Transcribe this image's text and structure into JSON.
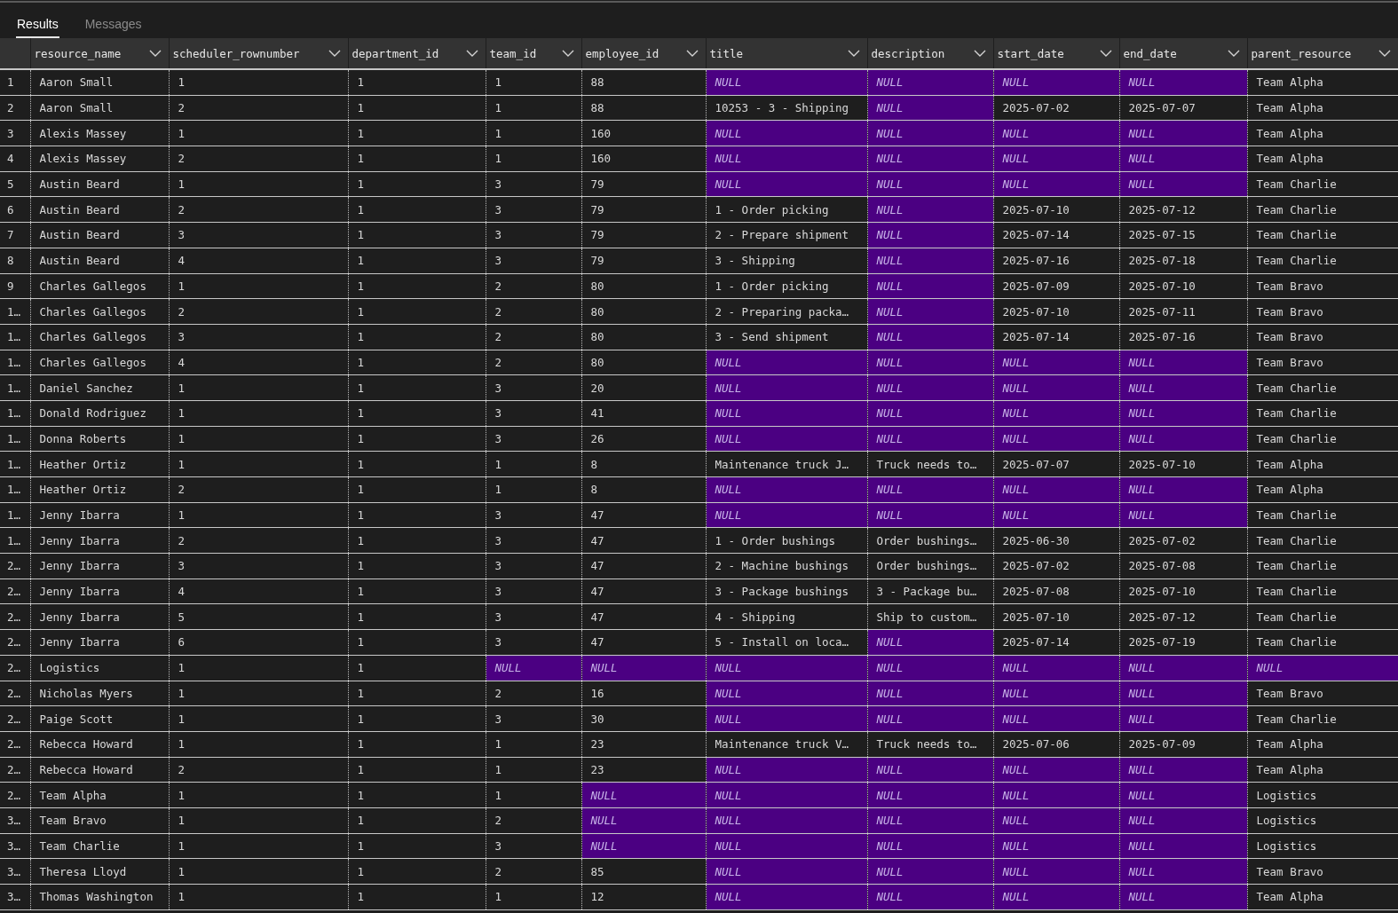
{
  "tabs": [
    {
      "label": "Results",
      "selected": true
    },
    {
      "label": "Messages",
      "selected": false
    }
  ],
  "table": {
    "columns": [
      "resource_name",
      "scheduler_rownumber",
      "department_id",
      "team_id",
      "employee_id",
      "title",
      "description",
      "start_date",
      "end_date",
      "parent_resource"
    ],
    "rows": [
      {
        "number": "1",
        "cells": [
          {
            "text": "Aaron Small",
            "is_null": false
          },
          {
            "text": "1",
            "is_null": false
          },
          {
            "text": "1",
            "is_null": false
          },
          {
            "text": "1",
            "is_null": false
          },
          {
            "text": "88",
            "is_null": false
          },
          {
            "text": "NULL",
            "is_null": true
          },
          {
            "text": "NULL",
            "is_null": true
          },
          {
            "text": "NULL",
            "is_null": true
          },
          {
            "text": "NULL",
            "is_null": true
          },
          {
            "text": "Team Alpha",
            "is_null": false
          }
        ]
      },
      {
        "number": "2",
        "cells": [
          {
            "text": "Aaron Small",
            "is_null": false
          },
          {
            "text": "2",
            "is_null": false
          },
          {
            "text": "1",
            "is_null": false
          },
          {
            "text": "1",
            "is_null": false
          },
          {
            "text": "88",
            "is_null": false
          },
          {
            "text": "10253 - 3 - Shipping",
            "is_null": false
          },
          {
            "text": "NULL",
            "is_null": true
          },
          {
            "text": "2025-07-02",
            "is_null": false
          },
          {
            "text": "2025-07-07",
            "is_null": false
          },
          {
            "text": "Team Alpha",
            "is_null": false
          }
        ]
      },
      {
        "number": "3",
        "cells": [
          {
            "text": "Alexis Massey",
            "is_null": false
          },
          {
            "text": "1",
            "is_null": false
          },
          {
            "text": "1",
            "is_null": false
          },
          {
            "text": "1",
            "is_null": false
          },
          {
            "text": "160",
            "is_null": false
          },
          {
            "text": "NULL",
            "is_null": true
          },
          {
            "text": "NULL",
            "is_null": true
          },
          {
            "text": "NULL",
            "is_null": true
          },
          {
            "text": "NULL",
            "is_null": true
          },
          {
            "text": "Team Alpha",
            "is_null": false
          }
        ]
      },
      {
        "number": "4",
        "cells": [
          {
            "text": "Alexis Massey",
            "is_null": false
          },
          {
            "text": "2",
            "is_null": false
          },
          {
            "text": "1",
            "is_null": false
          },
          {
            "text": "1",
            "is_null": false
          },
          {
            "text": "160",
            "is_null": false
          },
          {
            "text": "NULL",
            "is_null": true
          },
          {
            "text": "NULL",
            "is_null": true
          },
          {
            "text": "NULL",
            "is_null": true
          },
          {
            "text": "NULL",
            "is_null": true
          },
          {
            "text": "Team Alpha",
            "is_null": false
          }
        ]
      },
      {
        "number": "5",
        "cells": [
          {
            "text": "Austin Beard",
            "is_null": false
          },
          {
            "text": "1",
            "is_null": false
          },
          {
            "text": "1",
            "is_null": false
          },
          {
            "text": "3",
            "is_null": false
          },
          {
            "text": "79",
            "is_null": false
          },
          {
            "text": "NULL",
            "is_null": true
          },
          {
            "text": "NULL",
            "is_null": true
          },
          {
            "text": "NULL",
            "is_null": true
          },
          {
            "text": "NULL",
            "is_null": true
          },
          {
            "text": "Team Charlie",
            "is_null": false
          }
        ]
      },
      {
        "number": "6",
        "cells": [
          {
            "text": "Austin Beard",
            "is_null": false
          },
          {
            "text": "2",
            "is_null": false
          },
          {
            "text": "1",
            "is_null": false
          },
          {
            "text": "3",
            "is_null": false
          },
          {
            "text": "79",
            "is_null": false
          },
          {
            "text": "1 - Order picking",
            "is_null": false
          },
          {
            "text": "NULL",
            "is_null": true
          },
          {
            "text": "2025-07-10",
            "is_null": false
          },
          {
            "text": "2025-07-12",
            "is_null": false
          },
          {
            "text": "Team Charlie",
            "is_null": false
          }
        ]
      },
      {
        "number": "7",
        "cells": [
          {
            "text": "Austin Beard",
            "is_null": false
          },
          {
            "text": "3",
            "is_null": false
          },
          {
            "text": "1",
            "is_null": false
          },
          {
            "text": "3",
            "is_null": false
          },
          {
            "text": "79",
            "is_null": false
          },
          {
            "text": "2 - Prepare shipment",
            "is_null": false
          },
          {
            "text": "NULL",
            "is_null": true
          },
          {
            "text": "2025-07-14",
            "is_null": false
          },
          {
            "text": "2025-07-15",
            "is_null": false
          },
          {
            "text": "Team Charlie",
            "is_null": false
          }
        ]
      },
      {
        "number": "8",
        "cells": [
          {
            "text": "Austin Beard",
            "is_null": false
          },
          {
            "text": "4",
            "is_null": false
          },
          {
            "text": "1",
            "is_null": false
          },
          {
            "text": "3",
            "is_null": false
          },
          {
            "text": "79",
            "is_null": false
          },
          {
            "text": "3 - Shipping",
            "is_null": false
          },
          {
            "text": "NULL",
            "is_null": true
          },
          {
            "text": "2025-07-16",
            "is_null": false
          },
          {
            "text": "2025-07-18",
            "is_null": false
          },
          {
            "text": "Team Charlie",
            "is_null": false
          }
        ]
      },
      {
        "number": "9",
        "cells": [
          {
            "text": "Charles Gallegos",
            "is_null": false
          },
          {
            "text": "1",
            "is_null": false
          },
          {
            "text": "1",
            "is_null": false
          },
          {
            "text": "2",
            "is_null": false
          },
          {
            "text": "80",
            "is_null": false
          },
          {
            "text": "1 - Order picking",
            "is_null": false
          },
          {
            "text": "NULL",
            "is_null": true
          },
          {
            "text": "2025-07-09",
            "is_null": false
          },
          {
            "text": "2025-07-10",
            "is_null": false
          },
          {
            "text": "Team Bravo",
            "is_null": false
          }
        ]
      },
      {
        "number": "1…",
        "cells": [
          {
            "text": "Charles Gallegos",
            "is_null": false
          },
          {
            "text": "2",
            "is_null": false
          },
          {
            "text": "1",
            "is_null": false
          },
          {
            "text": "2",
            "is_null": false
          },
          {
            "text": "80",
            "is_null": false
          },
          {
            "text": "2 - Preparing packa…",
            "is_null": false
          },
          {
            "text": "NULL",
            "is_null": true
          },
          {
            "text": "2025-07-10",
            "is_null": false
          },
          {
            "text": "2025-07-11",
            "is_null": false
          },
          {
            "text": "Team Bravo",
            "is_null": false
          }
        ]
      },
      {
        "number": "1…",
        "cells": [
          {
            "text": "Charles Gallegos",
            "is_null": false
          },
          {
            "text": "3",
            "is_null": false
          },
          {
            "text": "1",
            "is_null": false
          },
          {
            "text": "2",
            "is_null": false
          },
          {
            "text": "80",
            "is_null": false
          },
          {
            "text": "3 - Send shipment",
            "is_null": false
          },
          {
            "text": "NULL",
            "is_null": true
          },
          {
            "text": "2025-07-14",
            "is_null": false
          },
          {
            "text": "2025-07-16",
            "is_null": false
          },
          {
            "text": "Team Bravo",
            "is_null": false
          }
        ]
      },
      {
        "number": "1…",
        "cells": [
          {
            "text": "Charles Gallegos",
            "is_null": false
          },
          {
            "text": "4",
            "is_null": false
          },
          {
            "text": "1",
            "is_null": false
          },
          {
            "text": "2",
            "is_null": false
          },
          {
            "text": "80",
            "is_null": false
          },
          {
            "text": "NULL",
            "is_null": true
          },
          {
            "text": "NULL",
            "is_null": true
          },
          {
            "text": "NULL",
            "is_null": true
          },
          {
            "text": "NULL",
            "is_null": true
          },
          {
            "text": "Team Bravo",
            "is_null": false
          }
        ]
      },
      {
        "number": "1…",
        "cells": [
          {
            "text": "Daniel Sanchez",
            "is_null": false
          },
          {
            "text": "1",
            "is_null": false
          },
          {
            "text": "1",
            "is_null": false
          },
          {
            "text": "3",
            "is_null": false
          },
          {
            "text": "20",
            "is_null": false
          },
          {
            "text": "NULL",
            "is_null": true
          },
          {
            "text": "NULL",
            "is_null": true
          },
          {
            "text": "NULL",
            "is_null": true
          },
          {
            "text": "NULL",
            "is_null": true
          },
          {
            "text": "Team Charlie",
            "is_null": false
          }
        ]
      },
      {
        "number": "1…",
        "cells": [
          {
            "text": "Donald Rodriguez",
            "is_null": false
          },
          {
            "text": "1",
            "is_null": false
          },
          {
            "text": "1",
            "is_null": false
          },
          {
            "text": "3",
            "is_null": false
          },
          {
            "text": "41",
            "is_null": false
          },
          {
            "text": "NULL",
            "is_null": true
          },
          {
            "text": "NULL",
            "is_null": true
          },
          {
            "text": "NULL",
            "is_null": true
          },
          {
            "text": "NULL",
            "is_null": true
          },
          {
            "text": "Team Charlie",
            "is_null": false
          }
        ]
      },
      {
        "number": "1…",
        "cells": [
          {
            "text": "Donna Roberts",
            "is_null": false
          },
          {
            "text": "1",
            "is_null": false
          },
          {
            "text": "1",
            "is_null": false
          },
          {
            "text": "3",
            "is_null": false
          },
          {
            "text": "26",
            "is_null": false
          },
          {
            "text": "NULL",
            "is_null": true
          },
          {
            "text": "NULL",
            "is_null": true
          },
          {
            "text": "NULL",
            "is_null": true
          },
          {
            "text": "NULL",
            "is_null": true
          },
          {
            "text": "Team Charlie",
            "is_null": false
          }
        ]
      },
      {
        "number": "1…",
        "cells": [
          {
            "text": "Heather Ortiz",
            "is_null": false
          },
          {
            "text": "1",
            "is_null": false
          },
          {
            "text": "1",
            "is_null": false
          },
          {
            "text": "1",
            "is_null": false
          },
          {
            "text": "8",
            "is_null": false
          },
          {
            "text": "Maintenance truck J…",
            "is_null": false
          },
          {
            "text": "Truck needs to…",
            "is_null": false
          },
          {
            "text": "2025-07-07",
            "is_null": false
          },
          {
            "text": "2025-07-10",
            "is_null": false
          },
          {
            "text": "Team Alpha",
            "is_null": false
          }
        ]
      },
      {
        "number": "1…",
        "cells": [
          {
            "text": "Heather Ortiz",
            "is_null": false
          },
          {
            "text": "2",
            "is_null": false
          },
          {
            "text": "1",
            "is_null": false
          },
          {
            "text": "1",
            "is_null": false
          },
          {
            "text": "8",
            "is_null": false
          },
          {
            "text": "NULL",
            "is_null": true
          },
          {
            "text": "NULL",
            "is_null": true
          },
          {
            "text": "NULL",
            "is_null": true
          },
          {
            "text": "NULL",
            "is_null": true
          },
          {
            "text": "Team Alpha",
            "is_null": false
          }
        ]
      },
      {
        "number": "1…",
        "cells": [
          {
            "text": "Jenny Ibarra",
            "is_null": false
          },
          {
            "text": "1",
            "is_null": false
          },
          {
            "text": "1",
            "is_null": false
          },
          {
            "text": "3",
            "is_null": false
          },
          {
            "text": "47",
            "is_null": false
          },
          {
            "text": "NULL",
            "is_null": true
          },
          {
            "text": "NULL",
            "is_null": true
          },
          {
            "text": "NULL",
            "is_null": true
          },
          {
            "text": "NULL",
            "is_null": true
          },
          {
            "text": "Team Charlie",
            "is_null": false
          }
        ]
      },
      {
        "number": "1…",
        "cells": [
          {
            "text": "Jenny Ibarra",
            "is_null": false
          },
          {
            "text": "2",
            "is_null": false
          },
          {
            "text": "1",
            "is_null": false
          },
          {
            "text": "3",
            "is_null": false
          },
          {
            "text": "47",
            "is_null": false
          },
          {
            "text": "1 - Order bushings",
            "is_null": false
          },
          {
            "text": "Order bushings…",
            "is_null": false
          },
          {
            "text": "2025-06-30",
            "is_null": false
          },
          {
            "text": "2025-07-02",
            "is_null": false
          },
          {
            "text": "Team Charlie",
            "is_null": false
          }
        ]
      },
      {
        "number": "2…",
        "cells": [
          {
            "text": "Jenny Ibarra",
            "is_null": false
          },
          {
            "text": "3",
            "is_null": false
          },
          {
            "text": "1",
            "is_null": false
          },
          {
            "text": "3",
            "is_null": false
          },
          {
            "text": "47",
            "is_null": false
          },
          {
            "text": "2 - Machine bushings",
            "is_null": false
          },
          {
            "text": "Order bushings…",
            "is_null": false
          },
          {
            "text": "2025-07-02",
            "is_null": false
          },
          {
            "text": "2025-07-08",
            "is_null": false
          },
          {
            "text": "Team Charlie",
            "is_null": false
          }
        ]
      },
      {
        "number": "2…",
        "cells": [
          {
            "text": "Jenny Ibarra",
            "is_null": false
          },
          {
            "text": "4",
            "is_null": false
          },
          {
            "text": "1",
            "is_null": false
          },
          {
            "text": "3",
            "is_null": false
          },
          {
            "text": "47",
            "is_null": false
          },
          {
            "text": "3 - Package bushings",
            "is_null": false
          },
          {
            "text": "3 - Package bu…",
            "is_null": false
          },
          {
            "text": "2025-07-08",
            "is_null": false
          },
          {
            "text": "2025-07-10",
            "is_null": false
          },
          {
            "text": "Team Charlie",
            "is_null": false
          }
        ]
      },
      {
        "number": "2…",
        "cells": [
          {
            "text": "Jenny Ibarra",
            "is_null": false
          },
          {
            "text": "5",
            "is_null": false
          },
          {
            "text": "1",
            "is_null": false
          },
          {
            "text": "3",
            "is_null": false
          },
          {
            "text": "47",
            "is_null": false
          },
          {
            "text": "4 - Shipping",
            "is_null": false
          },
          {
            "text": "Ship to custom…",
            "is_null": false
          },
          {
            "text": "2025-07-10",
            "is_null": false
          },
          {
            "text": "2025-07-12",
            "is_null": false
          },
          {
            "text": "Team Charlie",
            "is_null": false
          }
        ]
      },
      {
        "number": "2…",
        "cells": [
          {
            "text": "Jenny Ibarra",
            "is_null": false
          },
          {
            "text": "6",
            "is_null": false
          },
          {
            "text": "1",
            "is_null": false
          },
          {
            "text": "3",
            "is_null": false
          },
          {
            "text": "47",
            "is_null": false
          },
          {
            "text": "5 - Install on loca…",
            "is_null": false
          },
          {
            "text": "NULL",
            "is_null": true
          },
          {
            "text": "2025-07-14",
            "is_null": false
          },
          {
            "text": "2025-07-19",
            "is_null": false
          },
          {
            "text": "Team Charlie",
            "is_null": false
          }
        ]
      },
      {
        "number": "2…",
        "cells": [
          {
            "text": "Logistics",
            "is_null": false
          },
          {
            "text": "1",
            "is_null": false
          },
          {
            "text": "1",
            "is_null": false
          },
          {
            "text": "NULL",
            "is_null": true
          },
          {
            "text": "NULL",
            "is_null": true
          },
          {
            "text": "NULL",
            "is_null": true
          },
          {
            "text": "NULL",
            "is_null": true
          },
          {
            "text": "NULL",
            "is_null": true
          },
          {
            "text": "NULL",
            "is_null": true
          },
          {
            "text": "NULL",
            "is_null": true
          }
        ]
      },
      {
        "number": "2…",
        "cells": [
          {
            "text": "Nicholas Myers",
            "is_null": false
          },
          {
            "text": "1",
            "is_null": false
          },
          {
            "text": "1",
            "is_null": false
          },
          {
            "text": "2",
            "is_null": false
          },
          {
            "text": "16",
            "is_null": false
          },
          {
            "text": "NULL",
            "is_null": true
          },
          {
            "text": "NULL",
            "is_null": true
          },
          {
            "text": "NULL",
            "is_null": true
          },
          {
            "text": "NULL",
            "is_null": true
          },
          {
            "text": "Team Bravo",
            "is_null": false
          }
        ]
      },
      {
        "number": "2…",
        "cells": [
          {
            "text": "Paige Scott",
            "is_null": false
          },
          {
            "text": "1",
            "is_null": false
          },
          {
            "text": "1",
            "is_null": false
          },
          {
            "text": "3",
            "is_null": false
          },
          {
            "text": "30",
            "is_null": false
          },
          {
            "text": "NULL",
            "is_null": true
          },
          {
            "text": "NULL",
            "is_null": true
          },
          {
            "text": "NULL",
            "is_null": true
          },
          {
            "text": "NULL",
            "is_null": true
          },
          {
            "text": "Team Charlie",
            "is_null": false
          }
        ]
      },
      {
        "number": "2…",
        "cells": [
          {
            "text": "Rebecca Howard",
            "is_null": false
          },
          {
            "text": "1",
            "is_null": false
          },
          {
            "text": "1",
            "is_null": false
          },
          {
            "text": "1",
            "is_null": false
          },
          {
            "text": "23",
            "is_null": false
          },
          {
            "text": "Maintenance truck V…",
            "is_null": false
          },
          {
            "text": "Truck needs to…",
            "is_null": false
          },
          {
            "text": "2025-07-06",
            "is_null": false
          },
          {
            "text": "2025-07-09",
            "is_null": false
          },
          {
            "text": "Team Alpha",
            "is_null": false
          }
        ]
      },
      {
        "number": "2…",
        "cells": [
          {
            "text": "Rebecca Howard",
            "is_null": false
          },
          {
            "text": "2",
            "is_null": false
          },
          {
            "text": "1",
            "is_null": false
          },
          {
            "text": "1",
            "is_null": false
          },
          {
            "text": "23",
            "is_null": false
          },
          {
            "text": "NULL",
            "is_null": true
          },
          {
            "text": "NULL",
            "is_null": true
          },
          {
            "text": "NULL",
            "is_null": true
          },
          {
            "text": "NULL",
            "is_null": true
          },
          {
            "text": "Team Alpha",
            "is_null": false
          }
        ]
      },
      {
        "number": "2…",
        "cells": [
          {
            "text": "Team Alpha",
            "is_null": false
          },
          {
            "text": "1",
            "is_null": false
          },
          {
            "text": "1",
            "is_null": false
          },
          {
            "text": "1",
            "is_null": false
          },
          {
            "text": "NULL",
            "is_null": true
          },
          {
            "text": "NULL",
            "is_null": true
          },
          {
            "text": "NULL",
            "is_null": true
          },
          {
            "text": "NULL",
            "is_null": true
          },
          {
            "text": "NULL",
            "is_null": true
          },
          {
            "text": "Logistics",
            "is_null": false
          }
        ]
      },
      {
        "number": "3…",
        "cells": [
          {
            "text": "Team Bravo",
            "is_null": false
          },
          {
            "text": "1",
            "is_null": false
          },
          {
            "text": "1",
            "is_null": false
          },
          {
            "text": "2",
            "is_null": false
          },
          {
            "text": "NULL",
            "is_null": true
          },
          {
            "text": "NULL",
            "is_null": true
          },
          {
            "text": "NULL",
            "is_null": true
          },
          {
            "text": "NULL",
            "is_null": true
          },
          {
            "text": "NULL",
            "is_null": true
          },
          {
            "text": "Logistics",
            "is_null": false
          }
        ]
      },
      {
        "number": "3…",
        "cells": [
          {
            "text": "Team Charlie",
            "is_null": false
          },
          {
            "text": "1",
            "is_null": false
          },
          {
            "text": "1",
            "is_null": false
          },
          {
            "text": "3",
            "is_null": false
          },
          {
            "text": "NULL",
            "is_null": true
          },
          {
            "text": "NULL",
            "is_null": true
          },
          {
            "text": "NULL",
            "is_null": true
          },
          {
            "text": "NULL",
            "is_null": true
          },
          {
            "text": "NULL",
            "is_null": true
          },
          {
            "text": "Logistics",
            "is_null": false
          }
        ]
      },
      {
        "number": "3…",
        "cells": [
          {
            "text": "Theresa Lloyd",
            "is_null": false
          },
          {
            "text": "1",
            "is_null": false
          },
          {
            "text": "1",
            "is_null": false
          },
          {
            "text": "2",
            "is_null": false
          },
          {
            "text": "85",
            "is_null": false
          },
          {
            "text": "NULL",
            "is_null": true
          },
          {
            "text": "NULL",
            "is_null": true
          },
          {
            "text": "NULL",
            "is_null": true
          },
          {
            "text": "NULL",
            "is_null": true
          },
          {
            "text": "Team Bravo",
            "is_null": false
          }
        ]
      },
      {
        "number": "3…",
        "cells": [
          {
            "text": "Thomas Washington",
            "is_null": false
          },
          {
            "text": "1",
            "is_null": false
          },
          {
            "text": "1",
            "is_null": false
          },
          {
            "text": "1",
            "is_null": false
          },
          {
            "text": "12",
            "is_null": false
          },
          {
            "text": "NULL",
            "is_null": true
          },
          {
            "text": "NULL",
            "is_null": true
          },
          {
            "text": "NULL",
            "is_null": true
          },
          {
            "text": "NULL",
            "is_null": true
          },
          {
            "text": "Team Alpha",
            "is_null": false
          }
        ]
      }
    ]
  }
}
